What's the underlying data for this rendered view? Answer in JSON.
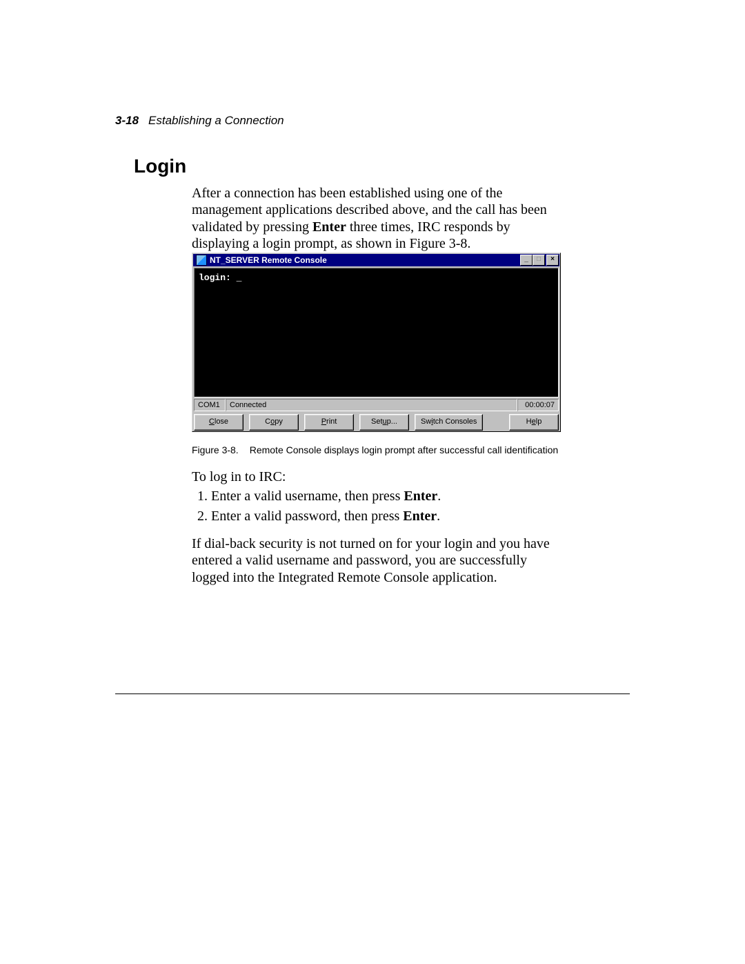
{
  "header": {
    "page_num": "3-18",
    "running_title": "Establishing a Connection"
  },
  "heading": "Login",
  "intro": {
    "t1": "After a connection has been established using one of the management applications described above, and the call has been validated by pressing ",
    "enter": "Enter",
    "t2": " three times, IRC responds by displaying a login prompt, as shown in Figure 3-8."
  },
  "window": {
    "title": "NT_SERVER Remote Console",
    "prompt": "login: _",
    "status": {
      "port": "COM1",
      "state": "Connected",
      "time": "00:00:07"
    },
    "buttons": {
      "close": {
        "u": "C",
        "rest": "lose"
      },
      "copy": {
        "pre": "C",
        "u": "o",
        "rest": "py"
      },
      "print": {
        "u": "P",
        "rest": "rint"
      },
      "setup": {
        "pre": "Set",
        "u": "u",
        "rest": "p..."
      },
      "switch": {
        "pre": "Sw",
        "u": "i",
        "rest": "tch Consoles"
      },
      "help": {
        "pre": "H",
        "u": "e",
        "rest": "lp"
      }
    },
    "winctl": {
      "min": "_",
      "max": "□",
      "close": "×"
    }
  },
  "caption": {
    "label": "Figure 3-8.",
    "text": "Remote Console displays login prompt after successful call identification"
  },
  "login_intro": "To log in to IRC:",
  "steps": {
    "s1a": "Enter a valid username, then press ",
    "s1b": "Enter",
    "s1c": ".",
    "s2a": "Enter a valid password, then press ",
    "s2b": "Enter",
    "s2c": "."
  },
  "closing": "If dial-back security is not turned on for your login and you have entered a valid username and password, you are successfully logged into the Integrated Remote Console application."
}
